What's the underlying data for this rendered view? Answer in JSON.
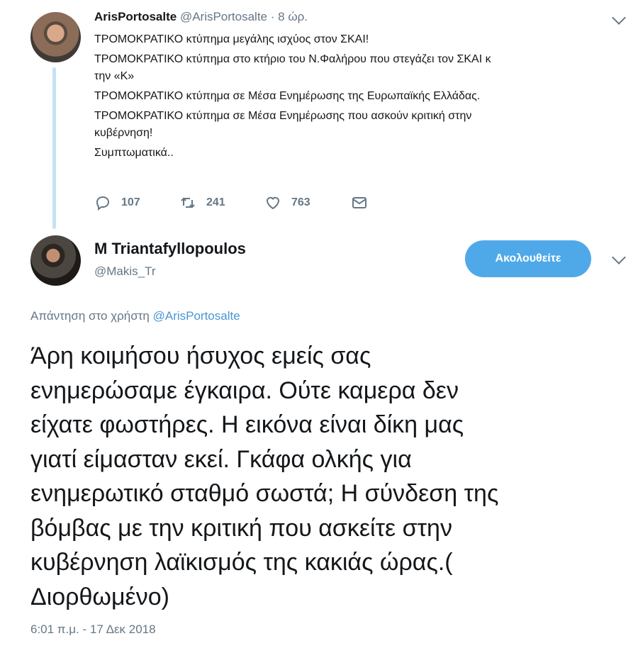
{
  "parent_tweet": {
    "name": "ArisPortosalte",
    "handle": "@ArisPortosalte",
    "separator": "·",
    "time": "8 ώρ.",
    "lines": [
      "ΤΡΟΜΟΚΡΑΤΙΚΟ κτύπημα μεγάλης ισχύος στον ΣΚΑΙ!",
      "ΤΡΟΜΟΚΡΑΤΙΚΟ κτύπημα στο κτήριο του Ν.Φαλήρου που στεγάζει τον ΣΚΑΙ κ",
      "την «Κ»",
      "ΤΡΟΜΟΚΡΑΤΙΚΟ κτύπημα σε Μέσα Ενημέρωσης της Ευρωπαϊκής Ελλάδας.",
      "ΤΡΟΜΟΚΡΑΤΙΚΟ κτύπημα σε Μέσα Ενημέρωσης που ασκούν κριτική στην",
      "κυβέρνηση!",
      "Συμπτωματικά.."
    ],
    "actions": {
      "replies": "107",
      "retweets": "241",
      "likes": "763"
    },
    "icons": [
      "reply-icon",
      "retweet-icon",
      "heart-icon",
      "mail-icon",
      "chevron-down-icon"
    ]
  },
  "main_tweet": {
    "name": "M Triantafyllopoulos",
    "handle": "@Makis_Tr",
    "follow_label": "Ακολουθείτε",
    "reply_prefix": "Απάντηση στο χρήστη",
    "reply_mention": "@ArisPortosalte",
    "text_lines": [
      "Άρη κοιμήσου ήσυχος εμείς σας",
      "ενημερώσαμε έγκαιρα. Ούτε καμερα δεν",
      "είχατε φωστήρες. Η εικόνα είναι δίκη μας",
      "γιατί είμασταν εκεί. Γκάφα ολκής για",
      "ενημερωτικό σταθμό σωστά; Η σύνδεση της",
      "βόμβας με την κριτική που ασκείτε στην",
      "κυβέρνηση λαϊκισμός της κακιάς ώρας.(",
      "Διορθωμένο)"
    ],
    "timestamp": "6:01 π.μ. - 17 Δεκ 2018"
  },
  "colors": {
    "accent": "#4fa9e9",
    "link": "#4a95d6",
    "muted": "#657786",
    "thread_line": "#c4e2f5",
    "text": "#14171a"
  }
}
